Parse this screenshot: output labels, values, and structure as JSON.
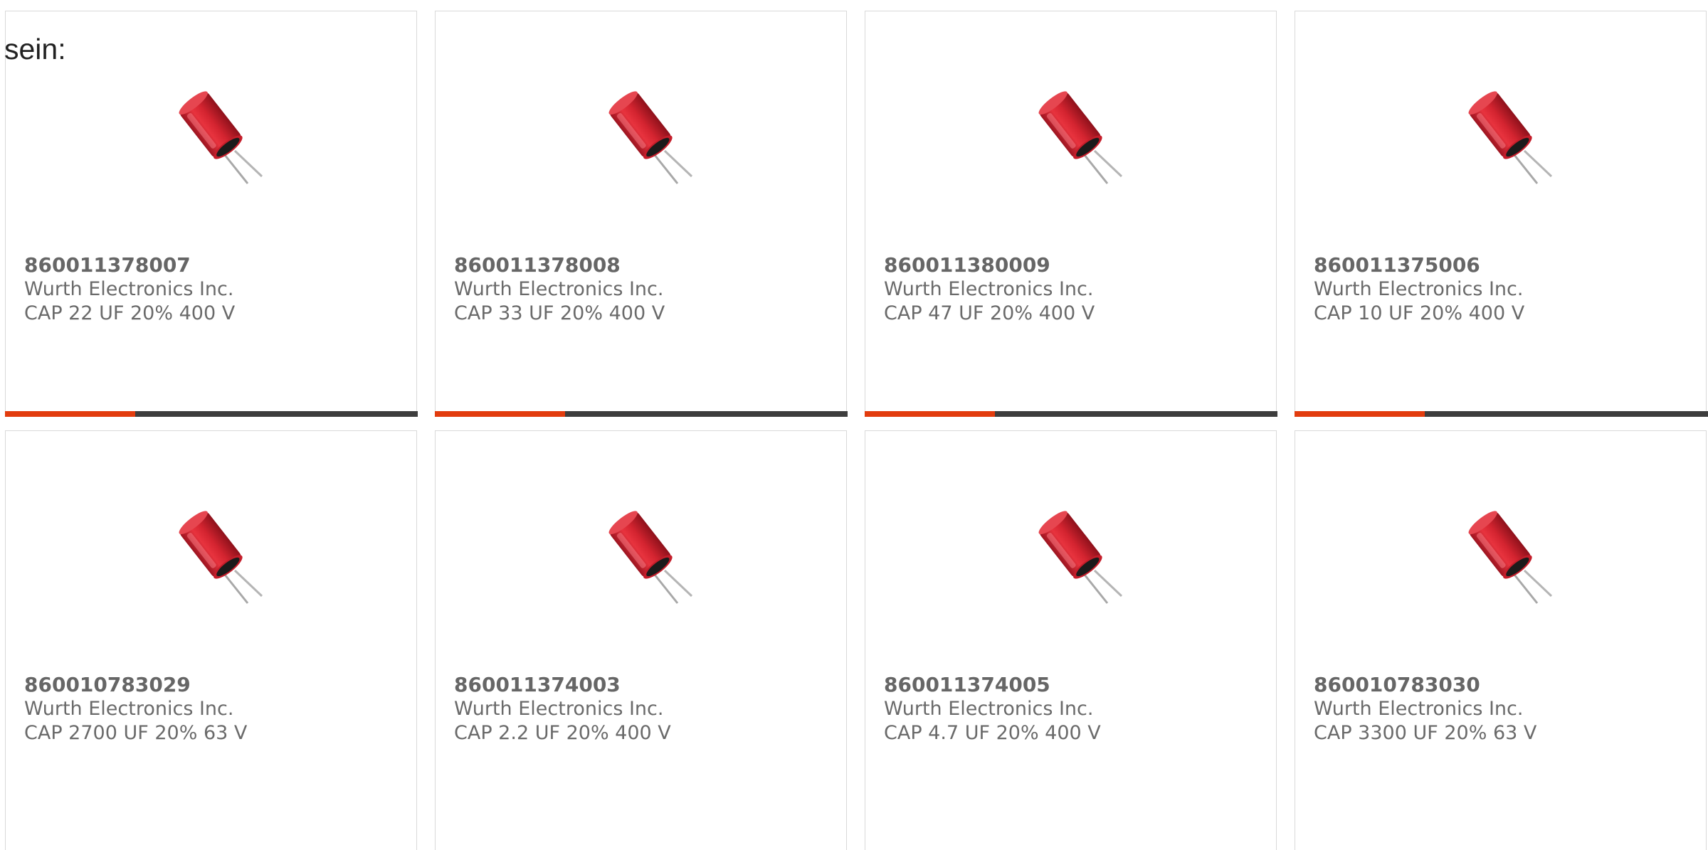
{
  "intro_text": "sein:",
  "colors": {
    "accent": "#e23c0e",
    "bar": "#3d3d3d",
    "text": "#666666"
  },
  "products": [
    {
      "part_number": "860011378007",
      "manufacturer": "Wurth Electronics Inc.",
      "description": "CAP 22 UF 20% 400 V",
      "image_icon": "capacitor-image"
    },
    {
      "part_number": "860011378008",
      "manufacturer": "Wurth Electronics Inc.",
      "description": "CAP 33 UF 20% 400 V",
      "image_icon": "capacitor-image"
    },
    {
      "part_number": "860011380009",
      "manufacturer": "Wurth Electronics Inc.",
      "description": "CAP 47 UF 20% 400 V",
      "image_icon": "capacitor-image"
    },
    {
      "part_number": "860011375006",
      "manufacturer": "Wurth Electronics Inc.",
      "description": "CAP 10 UF 20% 400 V",
      "image_icon": "capacitor-image"
    },
    {
      "part_number": "860010783029",
      "manufacturer": "Wurth Electronics Inc.",
      "description": "CAP 2700 UF 20% 63 V",
      "image_icon": "capacitor-image"
    },
    {
      "part_number": "860011374003",
      "manufacturer": "Wurth Electronics Inc.",
      "description": "CAP 2.2 UF 20% 400 V",
      "image_icon": "capacitor-image"
    },
    {
      "part_number": "860011374005",
      "manufacturer": "Wurth Electronics Inc.",
      "description": "CAP 4.7 UF 20% 400 V",
      "image_icon": "capacitor-image"
    },
    {
      "part_number": "860010783030",
      "manufacturer": "Wurth Electronics Inc.",
      "description": "CAP 3300 UF 20% 63 V",
      "image_icon": "capacitor-image"
    }
  ]
}
